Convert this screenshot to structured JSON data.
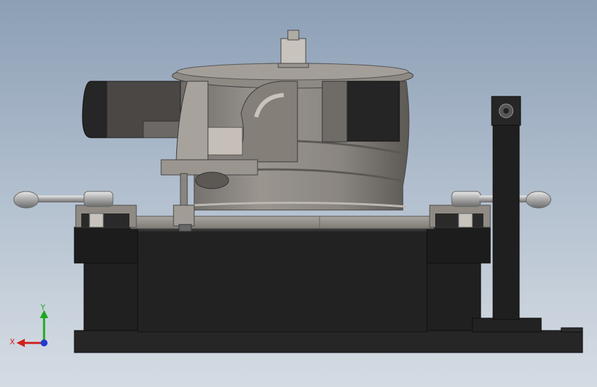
{
  "viewport": {
    "background_top": "#8c9fb5",
    "background_bottom": "#d4dbe3"
  },
  "triad": {
    "x_label": "X",
    "y_label": "Y",
    "x_color": "#d21e1e",
    "y_color": "#1ea81e",
    "z_color": "#1e3ad2"
  },
  "colors": {
    "base_dark": "#1e1e1e",
    "plate_grey": "#8e8983",
    "drum_grey": "#8a8580",
    "metal_light": "#cfcac4",
    "handle_metal": "#b8b8b8"
  },
  "icons": {
    "triad": "coordinate-triad-icon"
  }
}
